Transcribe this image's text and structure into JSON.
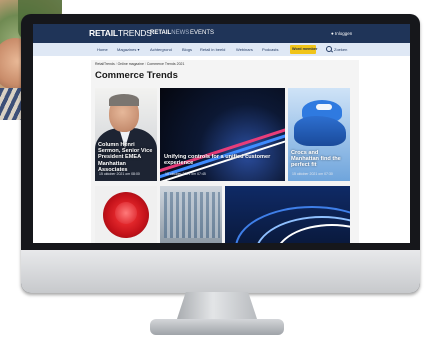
{
  "site": {
    "logo_bold": "RETAIL",
    "logo_light": "TRENDS",
    "logo2_bold": "RETAIL",
    "logo2_light": "NEWS",
    "events": "EVENTS",
    "login": "Inloggen"
  },
  "nav": {
    "items": [
      "Home",
      "Magazines ▾",
      "Achtergrond",
      "Blogs",
      "Retail in beeld",
      "Webinars",
      "Podcasts"
    ],
    "cta": "Word member",
    "search": "Zoeken"
  },
  "breadcrumb": [
    "RetailTrends",
    "Online magazine",
    "Commerce Trends 2021"
  ],
  "page_title": "Commerce Trends",
  "cards": [
    {
      "caption": "Column Henri Sermon, Senior Vice President EMEA Manhattan Associates",
      "date": "15 oktober 2021 om 08:00"
    },
    {
      "caption": "Unifying controls for a unified customer experience",
      "date": "15 oktober 2021 om 07:45"
    },
    {
      "caption": "Crocs and Manhattan find the perfect fit",
      "date": "15 oktober 2021 om 07:30"
    }
  ],
  "colors": {
    "topbar": "#1f3458",
    "navbar": "#dfe8f5",
    "cta": "#f0c419"
  }
}
